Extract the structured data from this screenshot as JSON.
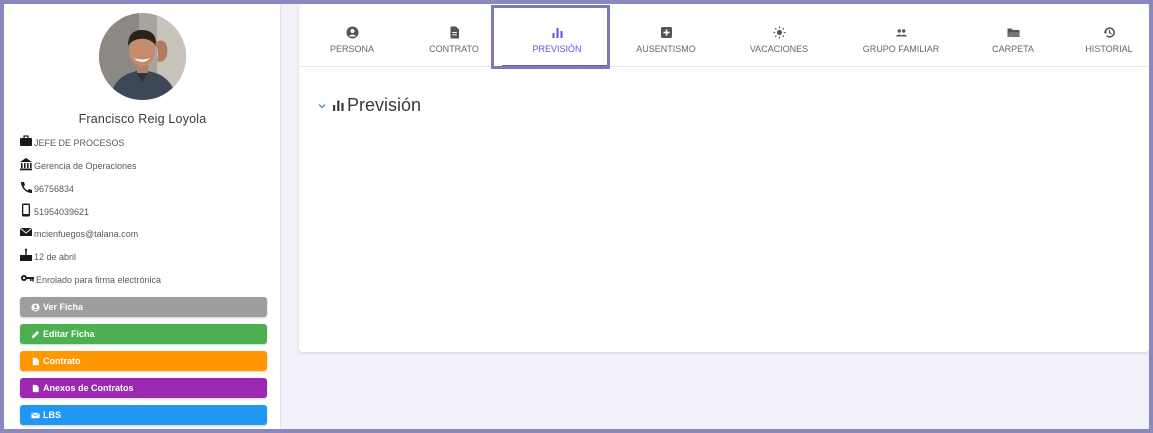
{
  "user": {
    "name": "Francisco Reig Loyola",
    "info": [
      {
        "icon": "briefcase-icon",
        "text": "JEFE DE PROCESOS"
      },
      {
        "icon": "bank-icon",
        "text": "Gerencia de Operaciones"
      },
      {
        "icon": "phone-icon",
        "text": "96756834"
      },
      {
        "icon": "mobile-icon",
        "text": "51954039621"
      },
      {
        "icon": "envelope-icon",
        "text": "mcienfuegos@talana.com"
      },
      {
        "icon": "birthday-cake-icon",
        "text": "12 de abril"
      },
      {
        "icon": "key-icon",
        "text": "Enrolado para firma electrónica"
      }
    ]
  },
  "actions": [
    {
      "label": "Ver Ficha",
      "color": "#9e9e9e",
      "icon": "user-circle-icon"
    },
    {
      "label": "Editar Ficha",
      "color": "#4caf50",
      "icon": "pencil-icon"
    },
    {
      "label": "Contrato",
      "color": "#ff9800",
      "icon": "file-icon"
    },
    {
      "label": "Anexos de Contratos",
      "color": "#9c27b0",
      "icon": "file-icon"
    },
    {
      "label": "LBS",
      "color": "#2196f3",
      "icon": "envelope-icon"
    }
  ],
  "tabs": [
    {
      "label": "PERSONA",
      "icon": "user-circle-icon"
    },
    {
      "label": "CONTRATO",
      "icon": "file-icon"
    },
    {
      "label": "PREVISIÓN",
      "icon": "bar-chart-icon",
      "active": true
    },
    {
      "label": "AUSENTISMO",
      "icon": "medical-plus-icon"
    },
    {
      "label": "VACACIONES",
      "icon": "sun-icon"
    },
    {
      "label": "GRUPO FAMILIAR",
      "icon": "people-icon"
    },
    {
      "label": "CARPETA",
      "icon": "folder-icon"
    },
    {
      "label": "HISTORIAL",
      "icon": "history-icon"
    }
  ],
  "section": {
    "title": "Previsión"
  },
  "colors": {
    "accent": "#6a4fd6",
    "highlight": "#7c78bd"
  }
}
